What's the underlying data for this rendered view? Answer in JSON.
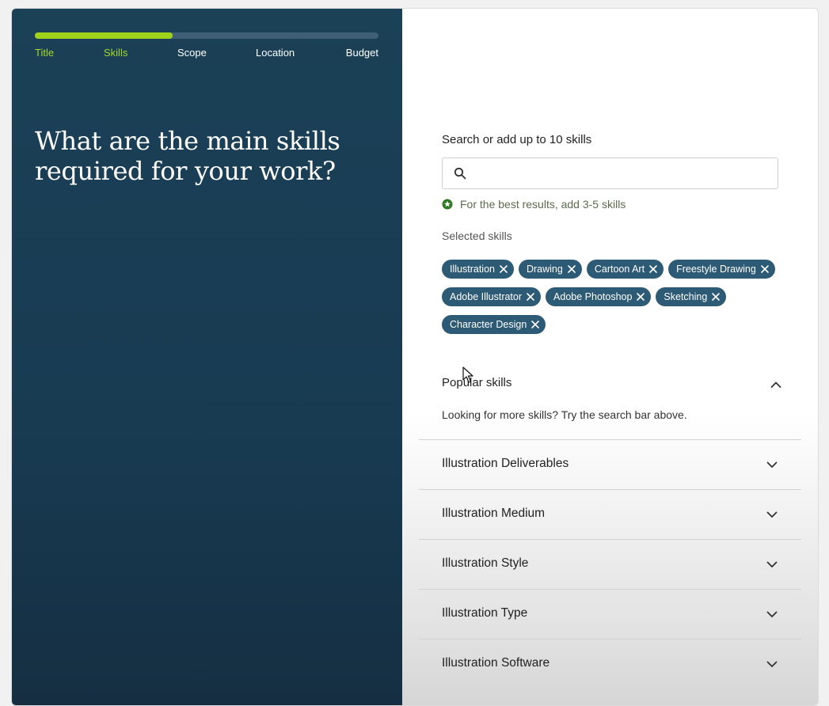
{
  "progress": {
    "fraction_complete": 0.4,
    "steps": [
      {
        "label": "Title",
        "state": "done"
      },
      {
        "label": "Skills",
        "state": "done"
      },
      {
        "label": "Scope",
        "state": "pending"
      },
      {
        "label": "Location",
        "state": "pending"
      },
      {
        "label": "Budget",
        "state": "pending"
      }
    ]
  },
  "headline": "What are the main skills required for your work?",
  "search": {
    "label": "Search or add up to 10 skills",
    "value": "",
    "placeholder": "",
    "icon": "search-icon"
  },
  "hint": {
    "icon": "star-badge-icon",
    "text": "For the best results, add 3-5 skills"
  },
  "selected": {
    "label": "Selected skills",
    "chips": [
      "Illustration",
      "Drawing",
      "Cartoon Art",
      "Freestyle Drawing",
      "Adobe Illustrator",
      "Adobe Photoshop",
      "Sketching",
      "Character Design"
    ]
  },
  "popular": {
    "title": "Popular skills",
    "description": "Looking for more skills? Try the search bar above.",
    "expanded": true
  },
  "categories": [
    "Illustration Deliverables",
    "Illustration Medium",
    "Illustration Style",
    "Illustration Type",
    "Illustration Software"
  ],
  "colors": {
    "left_panel_bg": "#1b4157",
    "progress_done": "#9fd31b",
    "chip_bg": "#2d5a74",
    "hint_icon": "#2f7a24"
  }
}
